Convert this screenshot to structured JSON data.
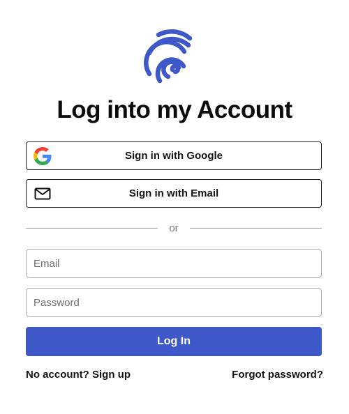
{
  "header": {
    "logo_icon": "fingerprint-icon",
    "title": "Log into my Account"
  },
  "social": {
    "google": {
      "label": "Sign in with Google",
      "icon": "google-icon"
    },
    "email": {
      "label": "Sign in with Email",
      "icon": "envelope-icon"
    }
  },
  "divider": {
    "label": "or"
  },
  "form": {
    "email": {
      "placeholder": "Email",
      "value": ""
    },
    "password": {
      "placeholder": "Password",
      "value": ""
    },
    "submit_label": "Log In"
  },
  "footer": {
    "signup_label": "No account? Sign up",
    "forgot_label": "Forgot password?"
  },
  "colors": {
    "brand": "#3f58c9",
    "logo": "#3f58c9",
    "text": "#111111",
    "border": "#a9a9a9"
  }
}
